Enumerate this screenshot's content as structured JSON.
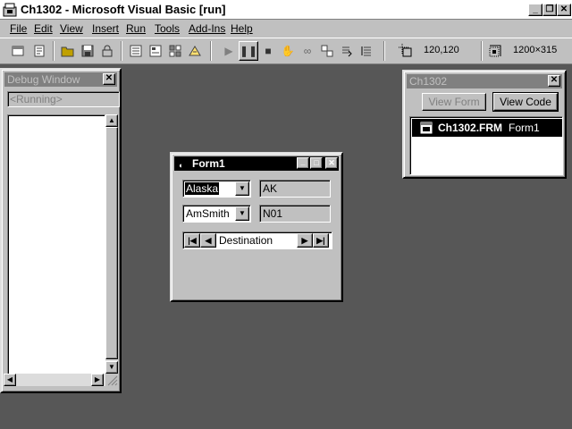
{
  "app": {
    "title": "Ch1302 - Microsoft Visual Basic [run]",
    "caption_buttons": [
      "_",
      "🗗",
      "✕"
    ]
  },
  "menu": [
    {
      "label": "File",
      "hotkey_index": 0
    },
    {
      "label": "Edit",
      "hotkey_index": 0
    },
    {
      "label": "View",
      "hotkey_index": 0
    },
    {
      "label": "Insert",
      "hotkey_index": 0
    },
    {
      "label": "Run",
      "hotkey_index": 0
    },
    {
      "label": "Tools",
      "hotkey_index": 0
    },
    {
      "label": "Add-Ins",
      "hotkey_index": 0
    },
    {
      "label": "Help",
      "hotkey_index": 0
    }
  ],
  "toolbar": {
    "position_readout": "120,120",
    "size_readout": "1200×315"
  },
  "debug_window": {
    "title": "Debug Window",
    "status": "<Running>"
  },
  "project_window": {
    "title": "Ch1302",
    "view_form_label": "View Form",
    "view_code_label": "View Code",
    "file_name": "Ch1302.FRM",
    "form_name": "Form1"
  },
  "form1": {
    "title": "Form1",
    "state_combo_value": "Alaska",
    "state_code": "AK",
    "name_combo_value": "AmSmith",
    "id_value": "N01",
    "data_control_caption": "Destination"
  },
  "colors": {
    "desktop": "#575757",
    "face": "#c0c0c0",
    "active_title": "#000000",
    "inactive_title": "#808080"
  }
}
